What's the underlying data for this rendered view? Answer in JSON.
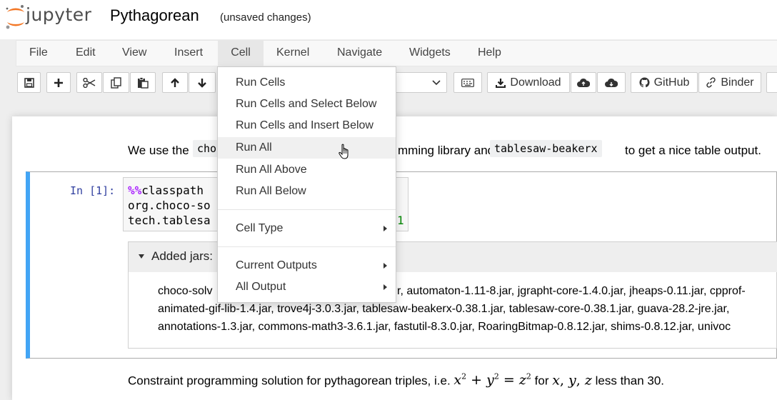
{
  "header": {
    "logo_text": "jupyter",
    "notebook_title": "Pythagorean",
    "save_status": "(unsaved changes)"
  },
  "menubar": [
    "File",
    "Edit",
    "View",
    "Insert",
    "Cell",
    "Kernel",
    "Navigate",
    "Widgets",
    "Help"
  ],
  "toolbar": {
    "download_label": "Download",
    "github_label": "GitHub",
    "binder_label": "Binder"
  },
  "dropdown": {
    "items": [
      "Run Cells",
      "Run Cells and Select Below",
      "Run Cells and Insert Below",
      "Run All",
      "Run All Above",
      "Run All Below",
      "Cell Type",
      "Current Outputs",
      "All Output"
    ],
    "highlighted": "Run All"
  },
  "notebook": {
    "intro": {
      "pre": "We use the",
      "code1": "cho",
      "mid": "mming library and",
      "code2": "tablesaw-beakerx",
      "post": "to get a nice table output."
    },
    "cell": {
      "prompt": "In [1]:",
      "magic": "%%",
      "line1": "classpath",
      "line2": "org.choco-so",
      "line3": "tech.tablesa",
      "line3_tail": "1"
    },
    "output": {
      "header": "Added jars:",
      "jar_lines": [
        "choco-solv",
        "r, automaton-1.11-8.jar, jgrapht-core-1.4.0.jar, jheaps-0.11.jar, cpprof-",
        "animated-gif-lib-1.4.jar, trove4j-3.0.3.jar, tablesaw-beakerx-0.38.1.jar, tablesaw-core-0.38.1.jar, guava-28.2-jre.jar,",
        "annotations-1.3.jar, commons-math3-3.6.1.jar, fastutil-8.3.0.jar, RoaringBitmap-0.8.12.jar, shims-0.8.12.jar, univoc"
      ]
    },
    "constraint": {
      "pre": "Constraint programming solution for pythagorean triples, i.e.",
      "formula_x": "x",
      "formula_y": "y",
      "formula_z": "z",
      "exp": "2",
      "plus": "+",
      "eq": "=",
      "mid": "for",
      "vars_x": "x",
      "vars_y": "y",
      "vars_z": "z",
      "comma": ",",
      "post": "less than 30."
    }
  }
}
